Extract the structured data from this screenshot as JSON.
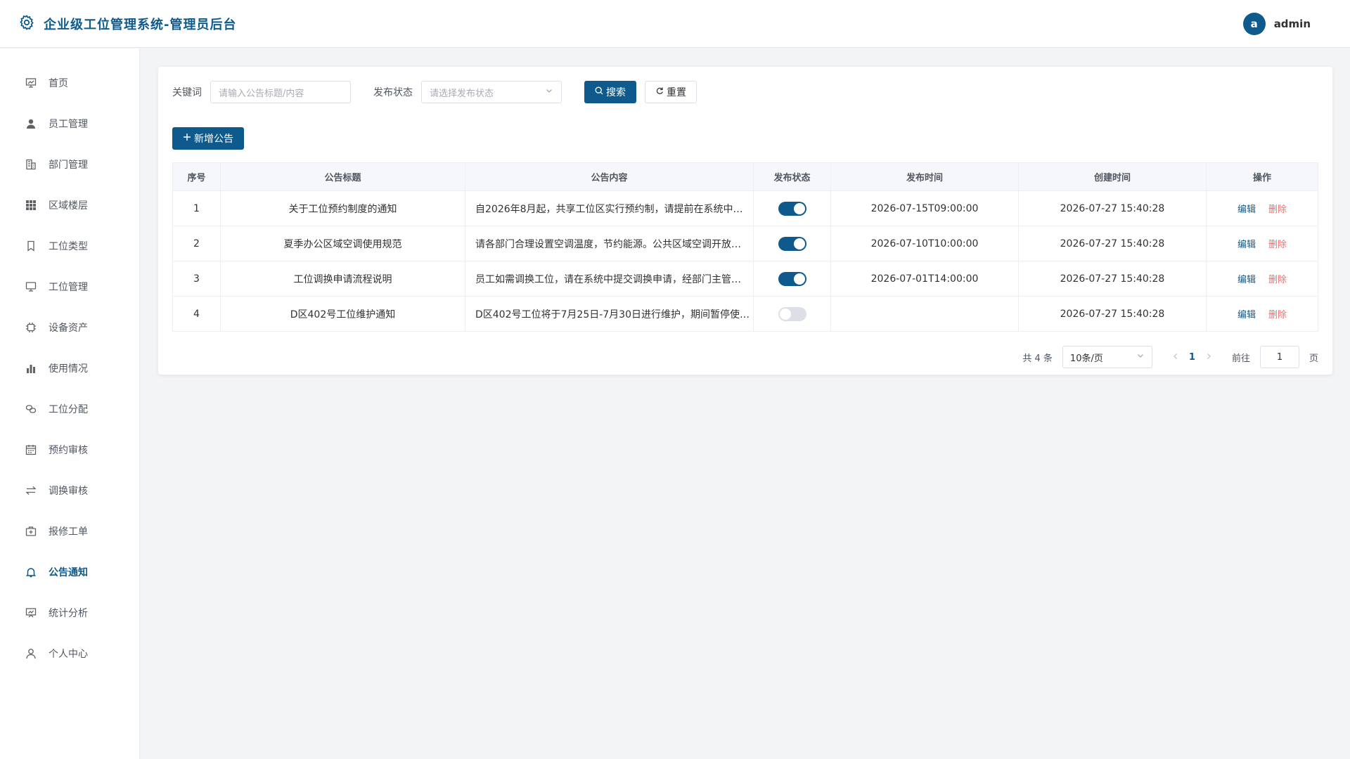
{
  "header": {
    "title": "企业级工位管理系统-管理员后台",
    "avatar_letter": "a",
    "username": "admin"
  },
  "sidebar": {
    "items": [
      {
        "label": "首页",
        "icon": "dashboard-icon",
        "active": false
      },
      {
        "label": "员工管理",
        "icon": "user-icon",
        "active": false
      },
      {
        "label": "部门管理",
        "icon": "building-icon",
        "active": false
      },
      {
        "label": "区域楼层",
        "icon": "grid-icon",
        "active": false
      },
      {
        "label": "工位类型",
        "icon": "bookmark-icon",
        "active": false
      },
      {
        "label": "工位管理",
        "icon": "monitor-icon",
        "active": false
      },
      {
        "label": "设备资产",
        "icon": "cpu-icon",
        "active": false
      },
      {
        "label": "使用情况",
        "icon": "bar-chart-icon",
        "active": false
      },
      {
        "label": "工位分配",
        "icon": "link-icon",
        "active": false
      },
      {
        "label": "预约审核",
        "icon": "calendar-icon",
        "active": false
      },
      {
        "label": "调换审核",
        "icon": "switch-icon",
        "active": false
      },
      {
        "label": "报修工单",
        "icon": "medkit-icon",
        "active": false
      },
      {
        "label": "公告通知",
        "icon": "bell-icon",
        "active": true
      },
      {
        "label": "统计分析",
        "icon": "presentation-icon",
        "active": false
      },
      {
        "label": "个人中心",
        "icon": "person-icon",
        "active": false
      }
    ]
  },
  "filters": {
    "keyword_label": "关键词",
    "keyword_placeholder": "请输入公告标题/内容",
    "status_label": "发布状态",
    "status_placeholder": "请选择发布状态",
    "search_label": "搜索",
    "reset_label": "重置"
  },
  "add_button_label": "新增公告",
  "table": {
    "columns": [
      "序号",
      "公告标题",
      "公告内容",
      "发布状态",
      "发布时间",
      "创建时间",
      "操作"
    ],
    "rows": [
      {
        "index": "1",
        "title": "关于工位预约制度的通知",
        "content": "自2026年8月起，共享工位区实行预约制，请提前在系统中…",
        "published": true,
        "publish_time": "2026-07-15T09:00:00",
        "created_time": "2026-07-27 15:40:28"
      },
      {
        "index": "2",
        "title": "夏季办公区域空调使用规范",
        "content": "请各部门合理设置空调温度，节约能源。公共区域空调开放…",
        "published": true,
        "publish_time": "2026-07-10T10:00:00",
        "created_time": "2026-07-27 15:40:28"
      },
      {
        "index": "3",
        "title": "工位调换申请流程说明",
        "content": "员工如需调换工位，请在系统中提交调换申请，经部门主管…",
        "published": true,
        "publish_time": "2026-07-01T14:00:00",
        "created_time": "2026-07-27 15:40:28"
      },
      {
        "index": "4",
        "title": "D区402号工位维护通知",
        "content": "D区402号工位将于7月25日-7月30日进行维护，期间暂停使…",
        "published": false,
        "publish_time": "",
        "created_time": "2026-07-27 15:40:28"
      }
    ],
    "edit_label": "编辑",
    "delete_label": "删除"
  },
  "pagination": {
    "total_text": "共 4 条",
    "page_size": "10条/页",
    "current_page": "1",
    "goto_label": "前往",
    "goto_value": "1",
    "page_suffix": "页"
  },
  "colors": {
    "primary": "#0f5a8c",
    "danger": "#f56c6c"
  }
}
